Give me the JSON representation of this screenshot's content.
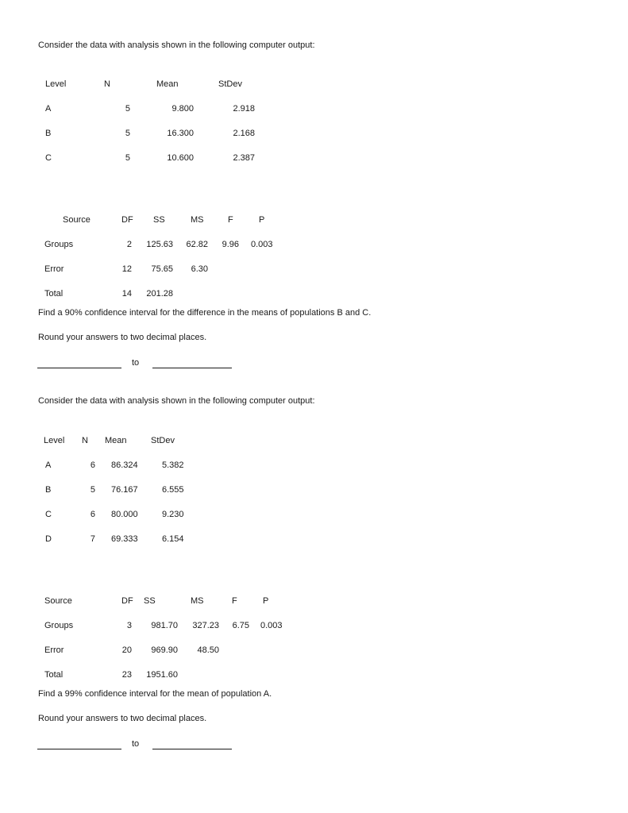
{
  "problems": [
    {
      "intro": "Consider the data with analysis shown in the following computer output:",
      "level_table": {
        "headers": [
          "Level",
          "N",
          "Mean",
          "StDev"
        ],
        "rows": [
          {
            "level": "A",
            "n": "5",
            "mean": "9.800",
            "stdev": "2.918"
          },
          {
            "level": "B",
            "n": "5",
            "mean": "16.300",
            "stdev": "2.168"
          },
          {
            "level": "C",
            "n": "5",
            "mean": "10.600",
            "stdev": "2.387"
          }
        ]
      },
      "anova_table": {
        "headers": [
          "Source",
          "DF",
          "SS",
          "MS",
          "F",
          "P"
        ],
        "rows": [
          {
            "source": "Groups",
            "df": "2",
            "ss": "125.63",
            "ms": "62.82",
            "f": "9.96",
            "p": "0.003"
          },
          {
            "source": "Error",
            "df": "12",
            "ss": "75.65",
            "ms": "6.30",
            "f": "",
            "p": ""
          },
          {
            "source": "Total",
            "df": "14",
            "ss": "201.28",
            "ms": "",
            "f": "",
            "p": ""
          }
        ]
      },
      "question": "Find a 90% confidence interval for the difference in the means of populations B and C.",
      "instruction": "Round your answers to two decimal places.",
      "answer": {
        "lower": "",
        "separator": "to",
        "upper": ""
      }
    },
    {
      "intro": "Consider the data with analysis shown in the following computer output:",
      "level_table": {
        "headers": [
          "Level",
          "N",
          "Mean",
          "StDev"
        ],
        "rows": [
          {
            "level": "A",
            "n": "6",
            "mean": "86.324",
            "stdev": "5.382"
          },
          {
            "level": "B",
            "n": "5",
            "mean": "76.167",
            "stdev": "6.555"
          },
          {
            "level": "C",
            "n": "6",
            "mean": "80.000",
            "stdev": "9.230"
          },
          {
            "level": "D",
            "n": "7",
            "mean": "69.333",
            "stdev": "6.154"
          }
        ]
      },
      "anova_table": {
        "headers": [
          "Source",
          "DF",
          "SS",
          "MS",
          "F",
          "P"
        ],
        "rows": [
          {
            "source": "Groups",
            "df": "3",
            "ss": "981.70",
            "ms": "327.23",
            "f": "6.75",
            "p": "0.003"
          },
          {
            "source": "Error",
            "df": "20",
            "ss": "969.90",
            "ms": "48.50",
            "f": "",
            "p": ""
          },
          {
            "source": "Total",
            "df": "23",
            "ss": "1951.60",
            "ms": "",
            "f": "",
            "p": ""
          }
        ]
      },
      "question": "Find a 99% confidence interval for the mean of population A.",
      "instruction": "Round your answers to two decimal places.",
      "answer": {
        "lower": "",
        "separator": "to",
        "upper": ""
      }
    }
  ]
}
